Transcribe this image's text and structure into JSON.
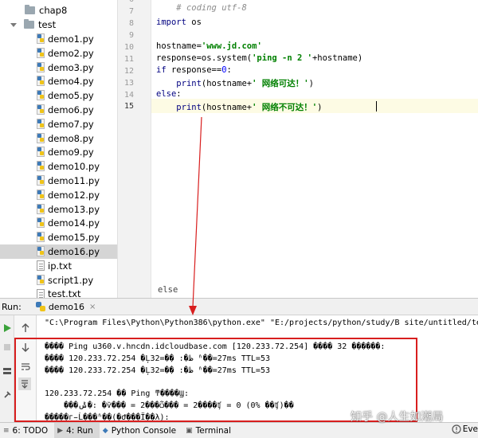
{
  "project_tree": {
    "items": [
      {
        "label": "chap8",
        "type": "folder",
        "indent": 1
      },
      {
        "label": "test",
        "type": "folder-open",
        "indent": 0
      },
      {
        "label": "demo1.py",
        "type": "py"
      },
      {
        "label": "demo2.py",
        "type": "py"
      },
      {
        "label": "demo3.py",
        "type": "py"
      },
      {
        "label": "demo4.py",
        "type": "py"
      },
      {
        "label": "demo5.py",
        "type": "py"
      },
      {
        "label": "demo6.py",
        "type": "py"
      },
      {
        "label": "demo7.py",
        "type": "py"
      },
      {
        "label": "demo8.py",
        "type": "py"
      },
      {
        "label": "demo9.py",
        "type": "py"
      },
      {
        "label": "demo10.py",
        "type": "py"
      },
      {
        "label": "demo11.py",
        "type": "py"
      },
      {
        "label": "demo12.py",
        "type": "py"
      },
      {
        "label": "demo13.py",
        "type": "py"
      },
      {
        "label": "demo14.py",
        "type": "py"
      },
      {
        "label": "demo15.py",
        "type": "py"
      },
      {
        "label": "demo16.py",
        "type": "py",
        "selected": true
      },
      {
        "label": "ip.txt",
        "type": "txt"
      },
      {
        "label": "script1.py",
        "type": "py"
      },
      {
        "label": "test.txt",
        "type": "txt"
      }
    ]
  },
  "editor": {
    "line_numbers": [
      "6",
      "7",
      "8",
      "9",
      "10",
      "11",
      "12",
      "13",
      "14",
      "15"
    ],
    "current_line": "15",
    "lines": {
      "l6_comment": "# coding utf-8",
      "l8_kw": "import",
      "l8_rest": " os",
      "l10_a": "hostname=",
      "l10_str": "'www.jd.com'",
      "l11_a": "response=os.system(",
      "l11_str": "'ping -n 2 '",
      "l11_b": "+hostname)",
      "l12_kw": "if",
      "l12_a": " response==",
      "l12_num": "0",
      "l12_b": ":",
      "l13_indent": "    ",
      "l13_fn": "print",
      "l13_a": "(hostname+",
      "l13_str": "' 网络可达！'",
      "l13_b": ")",
      "l14_kw": "else",
      "l14_b": ":",
      "l15_indent": "    ",
      "l15_fn": "print",
      "l15_a": "(hostname+",
      "l15_str": "' 网络不可达！'",
      "l15_b": ")"
    },
    "breadcrumb": "else"
  },
  "run_panel": {
    "label": "Run:",
    "tab_label": "demo16",
    "close": "×",
    "command": "\"C:\\Program Files\\Python\\Python386\\python.exe\" \"E:/projects/python/study/B site/untitled/test/de",
    "output": [
      "���� Ping u360.v.hncdn.idcloudbase.com [120.233.72.254] ���� 32 �ֽ�����:",
      "���� 120.233.72.254 �Ļظ�: �ֽ�=32 ʱ��=27ms TTL=53",
      "���� 120.233.72.254 �Ļظ�: �ֽ�=32 ʱ��=27ms TTL=53",
      "",
      "120.233.72.254 �� Ping ͳ����Ϣ:",
      "    ���ݰ�: �ѷ��� = 2���ѽ��� = 2����ʧ = 0 (0% ��ʧ)��",
      "�����г̵Ĺ���ʱ��(�Ժ���Ϊ��λ):"
    ]
  },
  "bottom_bar": {
    "tabs": [
      {
        "icon": "≡",
        "label": "6: TODO",
        "active": false
      },
      {
        "icon": "▶",
        "label": "4: Run",
        "active": true
      },
      {
        "icon": "◆",
        "label": "Python Console",
        "active": false
      },
      {
        "icon": "▣",
        "label": "Terminal",
        "active": false
      }
    ],
    "event_log": "Eve"
  },
  "watermark": "知乎 @人生如潮局",
  "colors": {
    "annotation_red": "#d81e1e",
    "keyword": "#000080",
    "string": "#008000",
    "number": "#0000ff",
    "selection": "#d5d5d5",
    "current_line": "#fdfbe4"
  }
}
